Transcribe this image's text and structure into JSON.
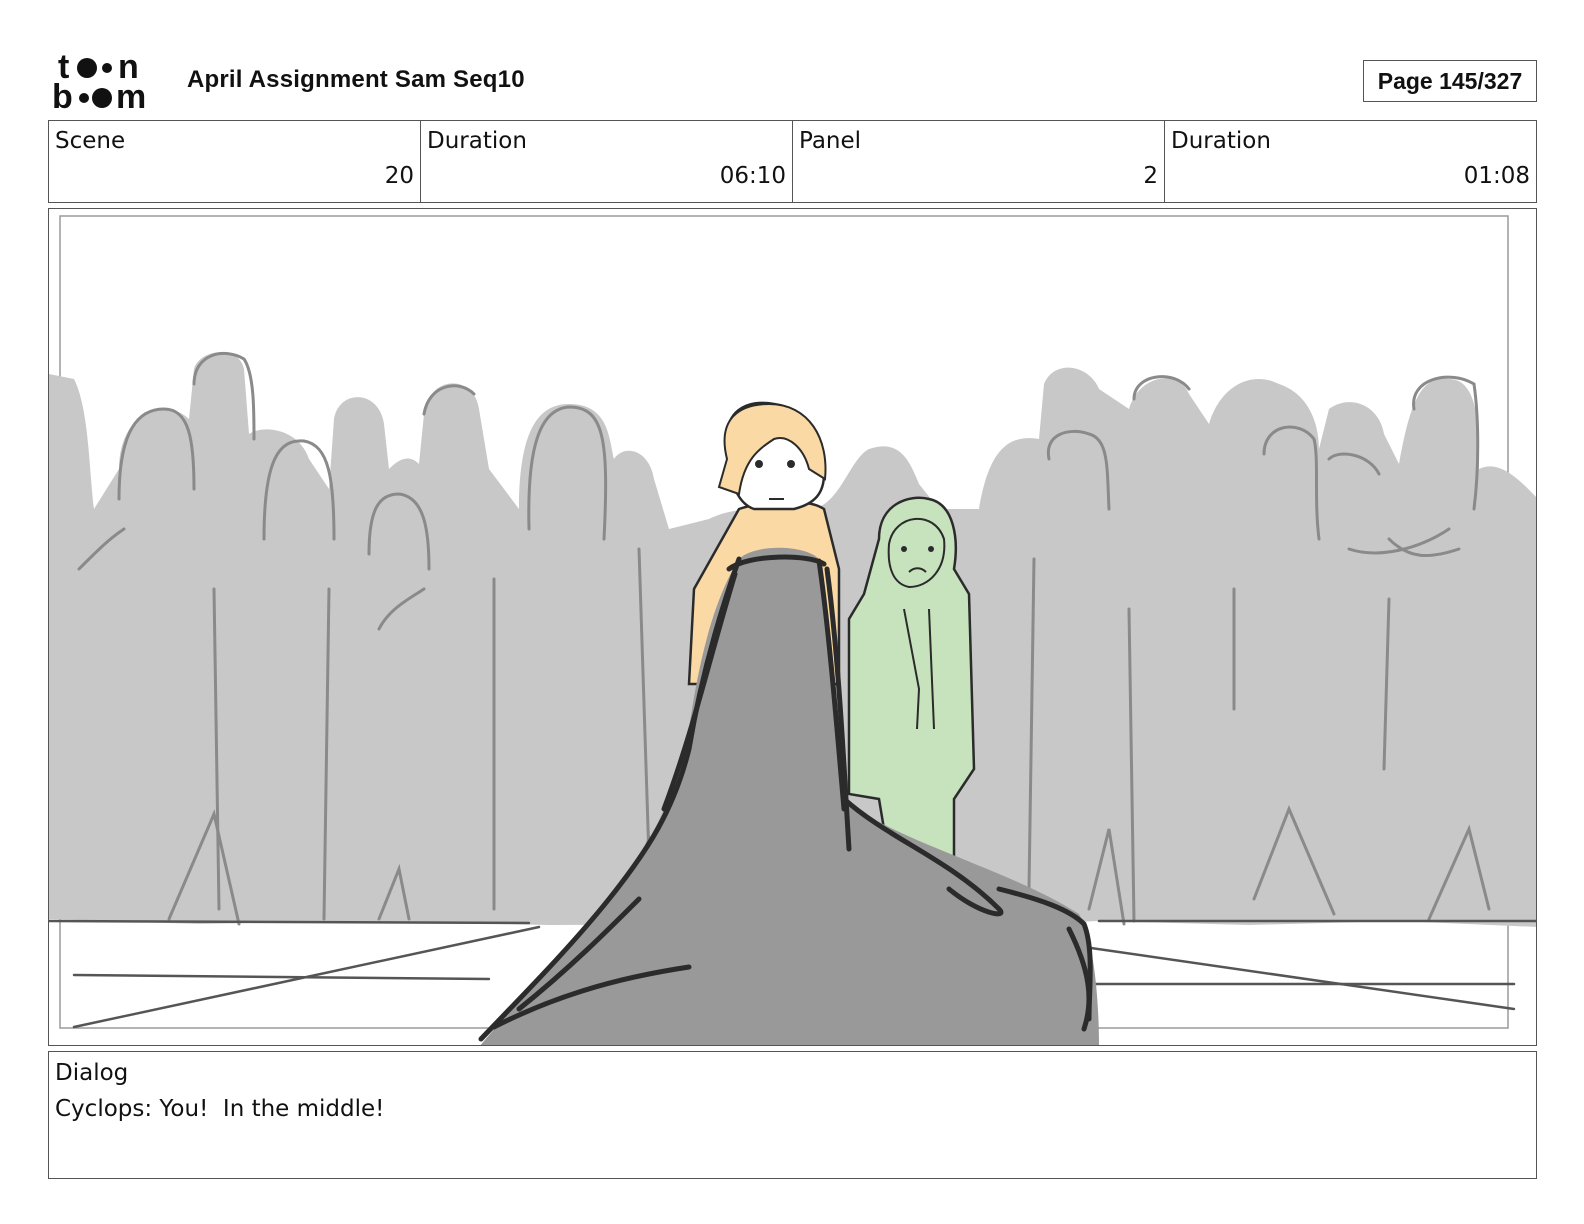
{
  "header": {
    "logo_text": "toon boom",
    "title": "April Assignment Sam Seq10",
    "page_label": "Page 145/327"
  },
  "info": [
    {
      "label": "Scene",
      "value": "20"
    },
    {
      "label": "Duration",
      "value": "06:10"
    },
    {
      "label": "Panel",
      "value": "2"
    },
    {
      "label": "Duration",
      "value": "01:08"
    }
  ],
  "panel": {
    "icon": "storyboard-sketch",
    "colors": {
      "crowd": "#c8c8c8",
      "crowd_lines": "#8a8a8a",
      "cyclops_fill": "#999999",
      "blonde_body": "#fbd9a4",
      "green_character": "#c6e3bd",
      "ink": "#2b2b2b"
    }
  },
  "dialog": {
    "label": "Dialog",
    "text": "Cyclops: You!  In the middle!"
  }
}
